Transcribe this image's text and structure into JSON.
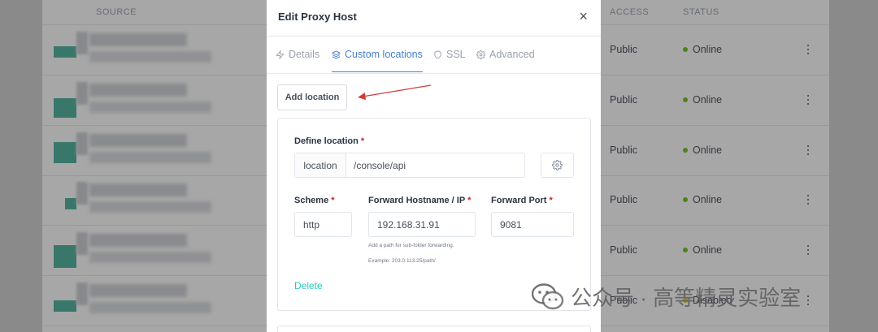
{
  "background": {
    "columns": {
      "source": "SOURCE",
      "access": "ACCESS",
      "status": "STATUS"
    },
    "rows": [
      {
        "access": "Public",
        "status": "Online"
      },
      {
        "access": "Public",
        "status": "Online"
      },
      {
        "access": "Public",
        "status": "Online"
      },
      {
        "access": "Public",
        "status": "Online"
      },
      {
        "access": "Public",
        "status": "Online"
      },
      {
        "access": "Public",
        "status": "Disabled"
      }
    ],
    "status_colors": {
      "online": "#5eba00"
    }
  },
  "modal": {
    "title": "Edit Proxy Host",
    "close_icon": "×",
    "tabs": [
      {
        "label": "Details",
        "icon": "zap-icon"
      },
      {
        "label": "Custom locations",
        "icon": "layers-icon",
        "active": true
      },
      {
        "label": "SSL",
        "icon": "shield-icon"
      },
      {
        "label": "Advanced",
        "icon": "gear-icon"
      }
    ],
    "add_location_label": "Add location",
    "location": {
      "define_label": "Define location",
      "required_mark": "*",
      "prefix": "location",
      "path": "/console/api",
      "scheme_label": "Scheme",
      "scheme": "http",
      "hostname_label": "Forward Hostname / IP",
      "hostname": "192.168.31.91",
      "port_label": "Forward Port",
      "port": "9081",
      "hint1": "Add a path for sub-folder forwarding.",
      "hint2": "Example: 203.0.113.25/path/",
      "delete_label": "Delete"
    },
    "accent": "#467fcf"
  },
  "watermark": {
    "text": "公众号 · 高等精灵实验室"
  }
}
